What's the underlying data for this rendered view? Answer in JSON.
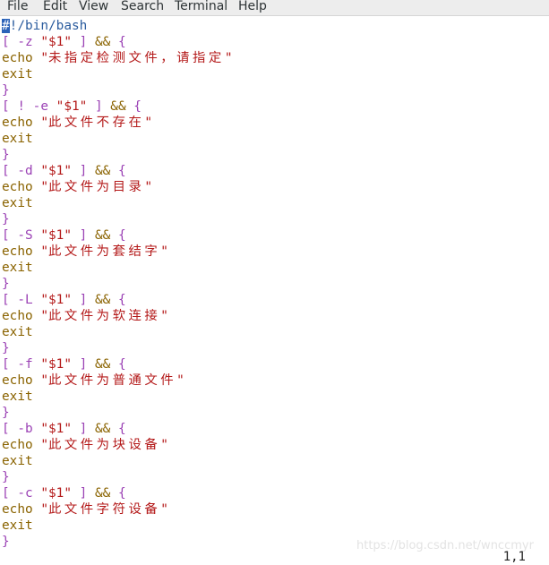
{
  "menubar": {
    "items": [
      "File",
      "Edit",
      "View",
      "Search",
      "Terminal",
      "Help"
    ]
  },
  "editor": {
    "lines": [
      [
        [
          "cursor",
          "#"
        ],
        [
          "shebang",
          "!/bin/bash"
        ]
      ],
      [
        [
          "op",
          "[ -z "
        ],
        [
          "str",
          "\"$1\""
        ],
        [
          "op",
          " ]"
        ],
        [
          "kw",
          " && "
        ],
        [
          "op",
          "{"
        ]
      ],
      [
        [
          "kw",
          "echo "
        ],
        [
          "str",
          "\""
        ],
        [
          "cjk",
          "未指定检测文件，请指定"
        ],
        [
          "str",
          "\""
        ]
      ],
      [
        [
          "kw",
          "exit"
        ]
      ],
      [
        [
          "op",
          "}"
        ]
      ],
      [
        [
          "op",
          "[ ! -e "
        ],
        [
          "str",
          "\"$1\""
        ],
        [
          "op",
          " ]"
        ],
        [
          "kw",
          " && "
        ],
        [
          "op",
          "{"
        ]
      ],
      [
        [
          "kw",
          "echo "
        ],
        [
          "str",
          "\""
        ],
        [
          "cjk",
          "此文件不存在"
        ],
        [
          "str",
          "\""
        ]
      ],
      [
        [
          "kw",
          "exit"
        ]
      ],
      [
        [
          "op",
          "}"
        ]
      ],
      [
        [
          "op",
          "[ -d "
        ],
        [
          "str",
          "\"$1\""
        ],
        [
          "op",
          " ]"
        ],
        [
          "kw",
          " && "
        ],
        [
          "op",
          "{"
        ]
      ],
      [
        [
          "kw",
          "echo "
        ],
        [
          "str",
          "\""
        ],
        [
          "cjk",
          "此文件为目录"
        ],
        [
          "str",
          "\""
        ]
      ],
      [
        [
          "kw",
          "exit"
        ]
      ],
      [
        [
          "op",
          "}"
        ]
      ],
      [
        [
          "op",
          "[ -S "
        ],
        [
          "str",
          "\"$1\""
        ],
        [
          "op",
          " ]"
        ],
        [
          "kw",
          " && "
        ],
        [
          "op",
          "{"
        ]
      ],
      [
        [
          "kw",
          "echo "
        ],
        [
          "str",
          "\""
        ],
        [
          "cjk",
          "此文件为套结字"
        ],
        [
          "str",
          "\""
        ]
      ],
      [
        [
          "kw",
          "exit"
        ]
      ],
      [
        [
          "op",
          "}"
        ]
      ],
      [
        [
          "op",
          "[ -L "
        ],
        [
          "str",
          "\"$1\""
        ],
        [
          "op",
          " ]"
        ],
        [
          "kw",
          " && "
        ],
        [
          "op",
          "{"
        ]
      ],
      [
        [
          "kw",
          "echo "
        ],
        [
          "str",
          "\""
        ],
        [
          "cjk",
          "此文件为软连接"
        ],
        [
          "str",
          "\""
        ]
      ],
      [
        [
          "kw",
          "exit"
        ]
      ],
      [
        [
          "op",
          "}"
        ]
      ],
      [
        [
          "op",
          "[ -f "
        ],
        [
          "str",
          "\"$1\""
        ],
        [
          "op",
          " ]"
        ],
        [
          "kw",
          " && "
        ],
        [
          "op",
          "{"
        ]
      ],
      [
        [
          "kw",
          "echo "
        ],
        [
          "str",
          "\""
        ],
        [
          "cjk",
          "此文件为普通文件"
        ],
        [
          "str",
          "\""
        ]
      ],
      [
        [
          "kw",
          "exit"
        ]
      ],
      [
        [
          "op",
          "}"
        ]
      ],
      [
        [
          "op",
          "[ -b "
        ],
        [
          "str",
          "\"$1\""
        ],
        [
          "op",
          " ]"
        ],
        [
          "kw",
          " && "
        ],
        [
          "op",
          "{"
        ]
      ],
      [
        [
          "kw",
          "echo "
        ],
        [
          "str",
          "\""
        ],
        [
          "cjk",
          "此文件为块设备"
        ],
        [
          "str",
          "\""
        ]
      ],
      [
        [
          "kw",
          "exit"
        ]
      ],
      [
        [
          "op",
          "}"
        ]
      ],
      [
        [
          "op",
          "[ -c "
        ],
        [
          "str",
          "\"$1\""
        ],
        [
          "op",
          " ]"
        ],
        [
          "kw",
          " && "
        ],
        [
          "op",
          "{"
        ]
      ],
      [
        [
          "kw",
          "echo "
        ],
        [
          "str",
          "\""
        ],
        [
          "cjk",
          "此文件字符设备"
        ],
        [
          "str",
          "\""
        ]
      ],
      [
        [
          "kw",
          "exit"
        ]
      ],
      [
        [
          "op",
          "}"
        ]
      ]
    ]
  },
  "status": {
    "cursor_position": "1,1"
  },
  "watermark": "https://blog.csdn.net/wnccmyr",
  "colors": {
    "cursor_bg": "#2b62b8",
    "shebang": "#2b5c9e",
    "operator": "#9b42b5",
    "string": "#b41a1a",
    "keyword": "#8a6300"
  }
}
